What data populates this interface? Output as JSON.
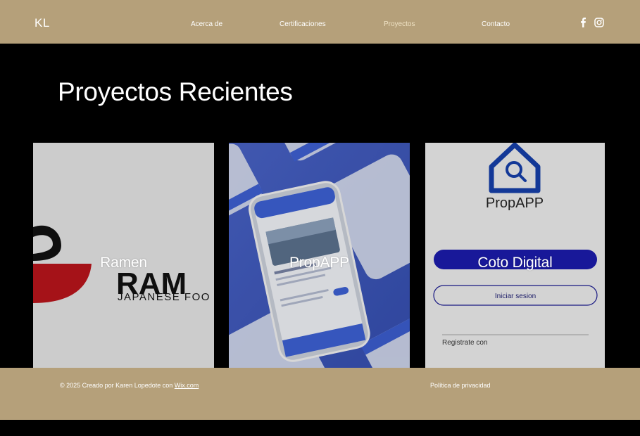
{
  "header": {
    "logo": "KL",
    "nav": [
      {
        "label": "Acerca de",
        "active": false
      },
      {
        "label": "Certificaciones",
        "active": false
      },
      {
        "label": "Proyectos",
        "active": true
      },
      {
        "label": "Contacto",
        "active": false
      }
    ],
    "social": [
      "facebook-icon",
      "instagram-icon"
    ]
  },
  "main": {
    "title": "Proyectos Recientes",
    "projects": [
      {
        "label": "Ramen",
        "image_text": "RAM",
        "image_subtext": "JAPANESE FOO"
      },
      {
        "label": "PropAPP"
      },
      {
        "label": "Coto Digital",
        "image_title": "PropAPP",
        "button_login": "Iniciar sesion",
        "register_text": "Registrate con"
      }
    ]
  },
  "footer": {
    "copyright_prefix": "© 2025 Creado por Karen Lopedote con ",
    "link_text": "Wix.com",
    "privacy": "Política de privacidad"
  },
  "colors": {
    "header_bg": "#b5a07a",
    "page_bg": "#000000",
    "active_nav": "#efe2c4"
  }
}
